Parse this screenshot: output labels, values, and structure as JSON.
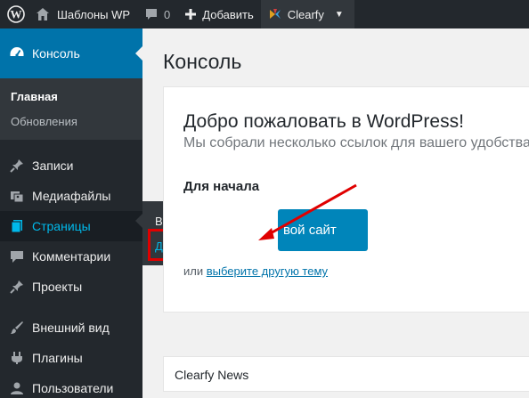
{
  "adminbar": {
    "site_name": "Шаблоны WP",
    "comments_count": "0",
    "new_label": "Добавить",
    "plugin_label": "Clearfy"
  },
  "sidebar": {
    "dashboard_label": "Консоль",
    "dashboard_sub": [
      "Главная",
      "Обновления"
    ],
    "items": [
      {
        "label": "Записи",
        "icon": "pin-icon"
      },
      {
        "label": "Медиафайлы",
        "icon": "media-icon"
      },
      {
        "label": "Страницы",
        "icon": "pages-icon"
      },
      {
        "label": "Комментарии",
        "icon": "comment-icon"
      },
      {
        "label": "Проекты",
        "icon": "pin-icon"
      },
      {
        "label": "Внешний вид",
        "icon": "brush-icon"
      },
      {
        "label": "Плагины",
        "icon": "plugin-icon"
      },
      {
        "label": "Пользователи",
        "icon": "users-icon"
      }
    ]
  },
  "flyout": {
    "all_pages": "Все страницы",
    "add_new": "Добавить новую"
  },
  "main": {
    "page_title": "Консоль",
    "welcome_title": "Добро пожаловать в WordPress!",
    "welcome_about": "Мы собрали несколько ссылок для вашего удобства:",
    "get_started": "Для начала",
    "cta_label": "вой сайт",
    "or_text": "или",
    "or_link": "выберите другую тему",
    "news_title": "Clearfy News"
  },
  "colors": {
    "adminbar": "#23282d",
    "accent": "#0073aa",
    "button": "#0085ba",
    "highlight": "#e00000"
  }
}
